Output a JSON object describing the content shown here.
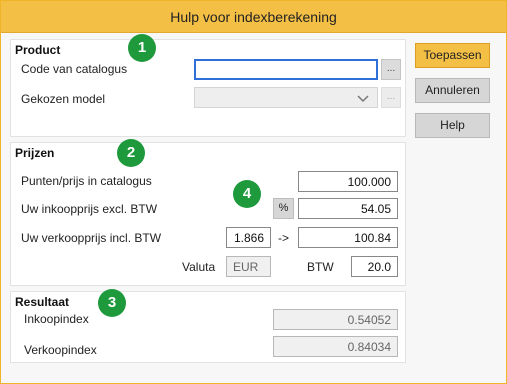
{
  "window": {
    "title": "Hulp voor indexberekening"
  },
  "buttons": {
    "apply": "Toepassen",
    "cancel": "Annuleren",
    "help": "Help"
  },
  "product": {
    "section_title": "Product",
    "catalog_code_label": "Code van catalogus",
    "catalog_code_value": "",
    "browse_label": "...",
    "model_label": "Gekozen model",
    "model_value": "",
    "model_browse_label": "..."
  },
  "prices": {
    "section_title": "Prijzen",
    "catalog_points_label": "Punten/prijs in catalogus",
    "catalog_points_value": "100.000",
    "purchase_price_label": "Uw inkoopprijs excl. BTW",
    "percent_label": "%",
    "purchase_price_value": "54.05",
    "sale_price_label": "Uw verkoopprijs incl. BTW",
    "sale_factor_value": "1.866",
    "arrow_label": "->",
    "sale_price_value": "100.84",
    "currency_label": "Valuta",
    "currency_value": "EUR",
    "vat_label": "BTW",
    "vat_value": "20.0"
  },
  "result": {
    "section_title": "Resultaat",
    "purchase_index_label": "Inkoopindex",
    "purchase_index_value": "0.54052",
    "sale_index_label": "Verkoopindex",
    "sale_index_value": "0.84034"
  },
  "badges": {
    "one": "1",
    "two": "2",
    "three": "3",
    "four": "4"
  },
  "colors": {
    "accent": "#f4bf45",
    "badge": "#1e9a3c",
    "focus": "#2f6fd8"
  }
}
